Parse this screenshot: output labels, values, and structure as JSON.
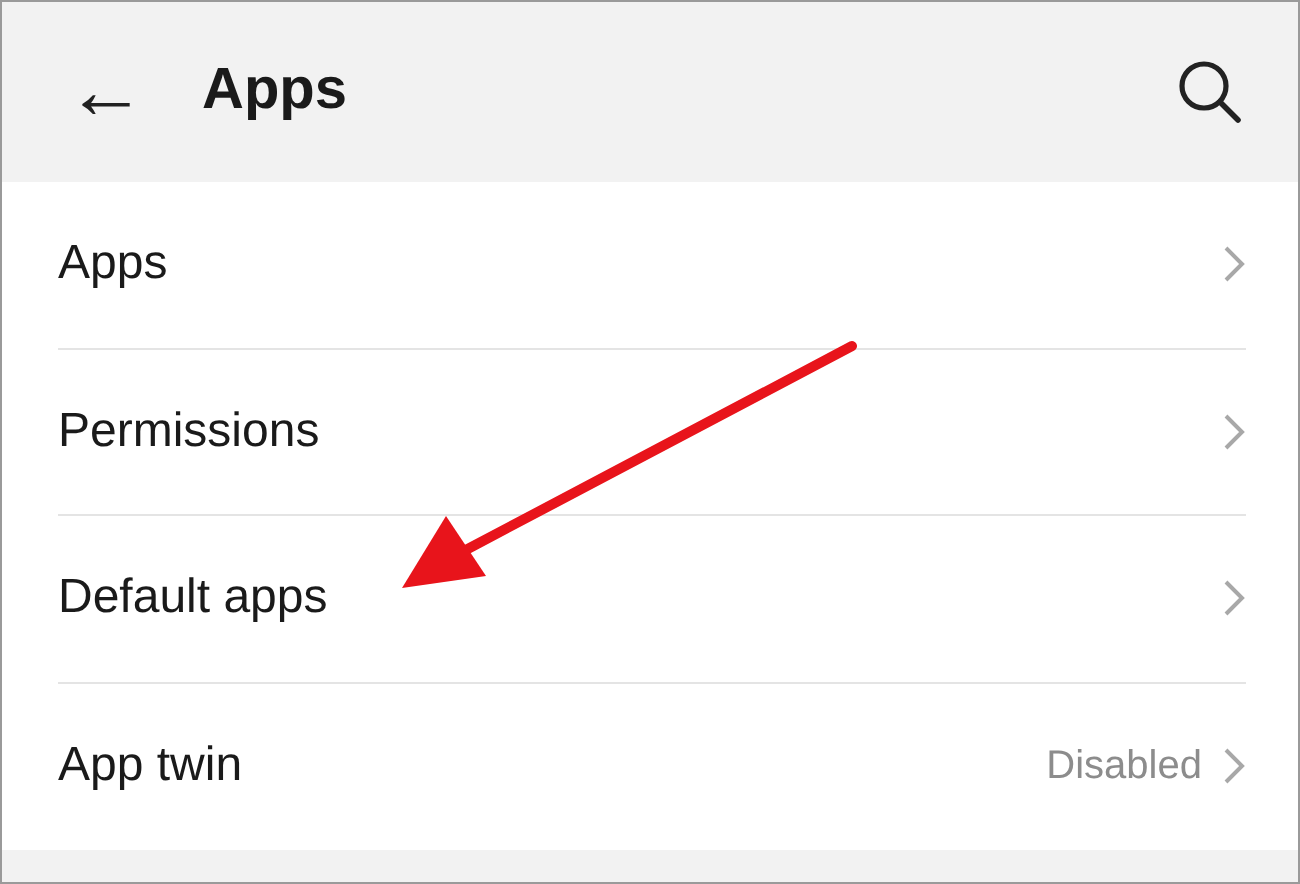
{
  "header": {
    "back": "←",
    "title": "Apps"
  },
  "rows": [
    {
      "label": "Apps"
    },
    {
      "label": "Permissions"
    },
    {
      "label": "Default apps"
    },
    {
      "label": "App twin",
      "value": "Disabled"
    }
  ]
}
